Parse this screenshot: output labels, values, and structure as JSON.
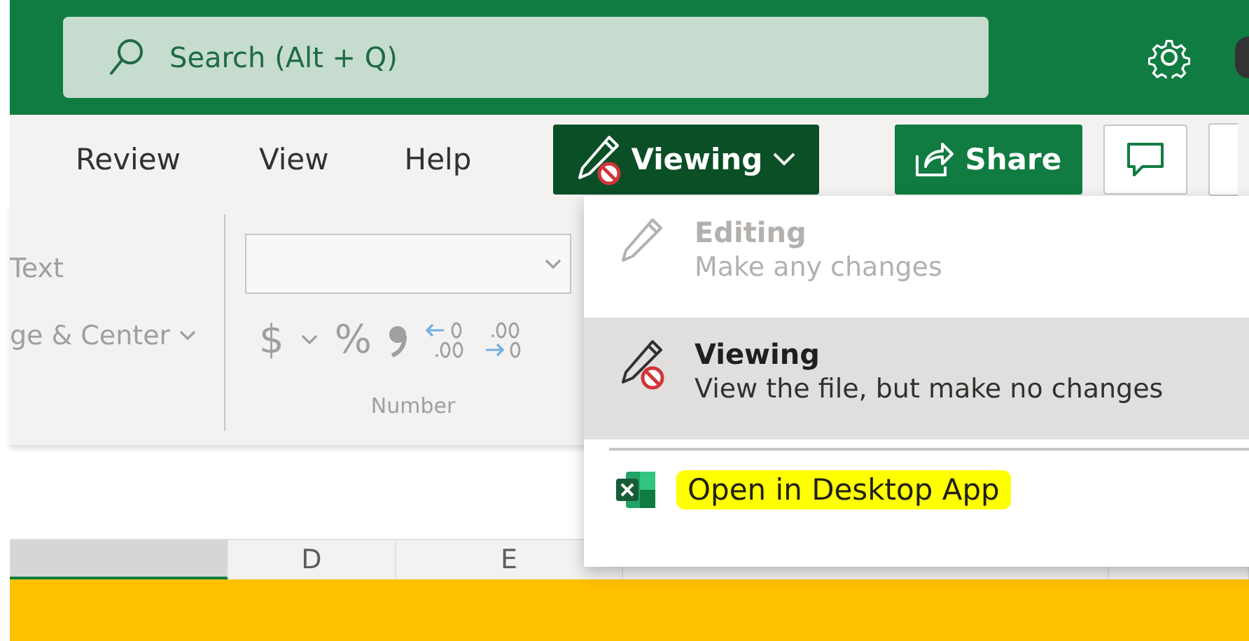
{
  "header": {
    "search": {
      "placeholder": "Search (Alt + Q)"
    }
  },
  "ribbon_tabs": [
    {
      "label": "Review",
      "selected": false
    },
    {
      "label": "View",
      "selected": false
    },
    {
      "label": "Help",
      "selected": false
    }
  ],
  "mode_button": {
    "label": "Viewing",
    "expanded": true
  },
  "share_button": {
    "label": "Share"
  },
  "ribbon": {
    "alignment": [
      {
        "label": "Text",
        "kind": "plain"
      },
      {
        "label": "ge & Center",
        "kind": "dropdown"
      }
    ],
    "number": {
      "currency": "$",
      "percent": "%",
      "group_label": "Number"
    }
  },
  "columns": [
    {
      "selected": true
    },
    {
      "label": "D",
      "selected": false
    },
    {
      "label": "E",
      "selected": false
    },
    {
      "selected": false
    },
    {
      "selected": false
    }
  ],
  "menu": {
    "items": [
      {
        "kind": "mode",
        "title": "Editing",
        "description": "Make any changes",
        "disabled": true,
        "selected": false
      },
      {
        "kind": "mode",
        "title": "Viewing",
        "description": "View the file, but make no changes",
        "disabled": false,
        "selected": true
      },
      {
        "kind": "divider"
      },
      {
        "kind": "action",
        "title": "Open in Desktop App",
        "highlighted": true
      }
    ]
  }
}
